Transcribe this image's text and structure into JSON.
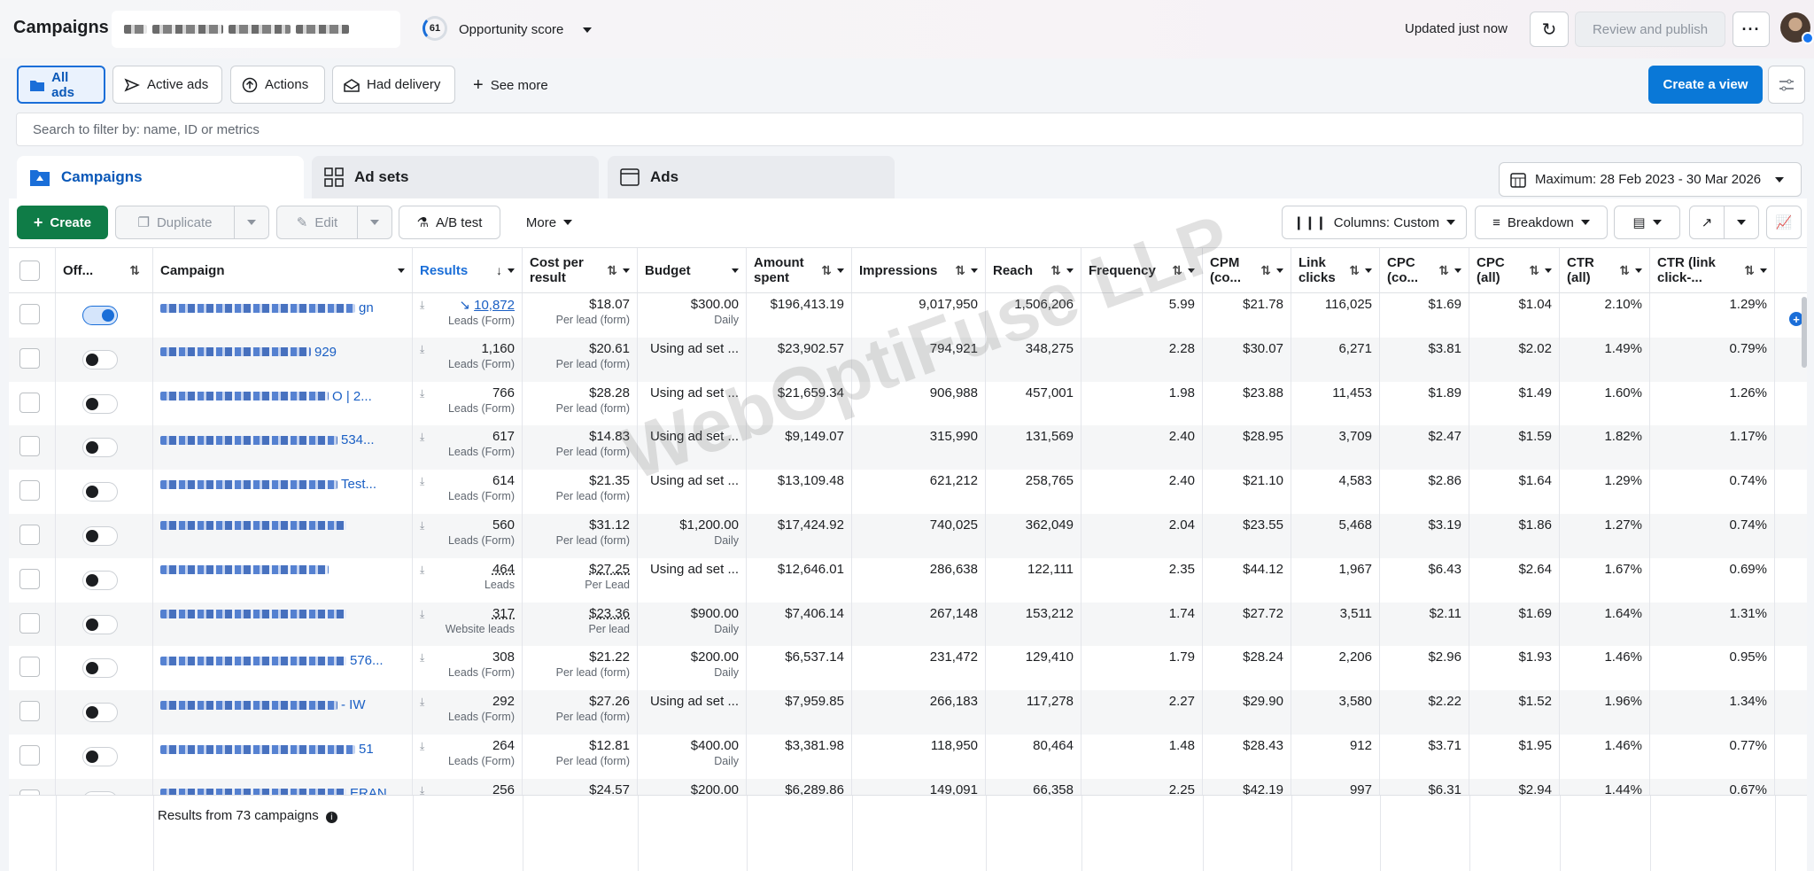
{
  "header": {
    "title": "Campaigns",
    "opportunity_score": "61",
    "opportunity_label": "Opportunity score",
    "updated": "Updated just now",
    "review_publish": "Review and publish"
  },
  "filters": {
    "chips": [
      "All ads",
      "Active ads",
      "Actions",
      "Had delivery"
    ],
    "see_more": "See more",
    "create_view": "Create a view"
  },
  "search": {
    "placeholder": "Search to filter by: name, ID or metrics"
  },
  "levels": {
    "campaigns": "Campaigns",
    "ad_sets": "Ad sets",
    "ads": "Ads"
  },
  "date_range": "Maximum: 28 Feb 2023 - 30 Mar 2026",
  "toolbar": {
    "create": "Create",
    "duplicate": "Duplicate",
    "edit": "Edit",
    "ab_test": "A/B test",
    "more": "More",
    "columns": "Columns: Custom",
    "breakdown": "Breakdown"
  },
  "columns": [
    "Off...",
    "Campaign",
    "Results",
    "Cost per result",
    "Budget",
    "Amount spent",
    "Impressions",
    "Reach",
    "Frequency",
    "CPM (co...",
    "Link clicks",
    "CPC (co...",
    "CPC (all)",
    "CTR (all)",
    "CTR (link click-..."
  ],
  "rows": [
    {
      "name_visible": "gn",
      "on": true,
      "results": "10,872",
      "results_type": "Leads (Form)",
      "cpr": "$18.07",
      "cpr_type": "Per lead (form)",
      "budget": "$300.00",
      "budget_type": "Daily",
      "spent": "$196,413.19",
      "impressions": "9,017,950",
      "reach": "1,506,206",
      "frequency": "5.99",
      "cpm": "$21.78",
      "link_clicks": "116,025",
      "cpc_co": "$1.69",
      "cpc_all": "$1.04",
      "ctr_all": "2.10%",
      "ctr_link": "1.29%"
    },
    {
      "name_visible": "929",
      "on": false,
      "results": "1,160",
      "results_type": "Leads (Form)",
      "cpr": "$20.61",
      "cpr_type": "Per lead (form)",
      "budget": "Using ad set ...",
      "budget_type": "",
      "spent": "$23,902.57",
      "impressions": "794,921",
      "reach": "348,275",
      "frequency": "2.28",
      "cpm": "$30.07",
      "link_clicks": "6,271",
      "cpc_co": "$3.81",
      "cpc_all": "$2.02",
      "ctr_all": "1.49%",
      "ctr_link": "0.79%"
    },
    {
      "name_visible": "O | 2...",
      "on": false,
      "results": "766",
      "results_type": "Leads (Form)",
      "cpr": "$28.28",
      "cpr_type": "Per lead (form)",
      "budget": "Using ad set ...",
      "budget_type": "",
      "spent": "$21,659.34",
      "impressions": "906,988",
      "reach": "457,001",
      "frequency": "1.98",
      "cpm": "$23.88",
      "link_clicks": "11,453",
      "cpc_co": "$1.89",
      "cpc_all": "$1.49",
      "ctr_all": "1.60%",
      "ctr_link": "1.26%"
    },
    {
      "name_visible": "534...",
      "on": false,
      "results": "617",
      "results_type": "Leads (Form)",
      "cpr": "$14.83",
      "cpr_type": "Per lead (form)",
      "budget": "Using ad set ...",
      "budget_type": "",
      "spent": "$9,149.07",
      "impressions": "315,990",
      "reach": "131,569",
      "frequency": "2.40",
      "cpm": "$28.95",
      "link_clicks": "3,709",
      "cpc_co": "$2.47",
      "cpc_all": "$1.59",
      "ctr_all": "1.82%",
      "ctr_link": "1.17%"
    },
    {
      "name_visible": "Test...",
      "on": false,
      "results": "614",
      "results_type": "Leads (Form)",
      "cpr": "$21.35",
      "cpr_type": "Per lead (form)",
      "budget": "Using ad set ...",
      "budget_type": "",
      "spent": "$13,109.48",
      "impressions": "621,212",
      "reach": "258,765",
      "frequency": "2.40",
      "cpm": "$21.10",
      "link_clicks": "4,583",
      "cpc_co": "$2.86",
      "cpc_all": "$1.64",
      "ctr_all": "1.29%",
      "ctr_link": "0.74%"
    },
    {
      "name_visible": "",
      "on": false,
      "results": "560",
      "results_type": "Leads (Form)",
      "cpr": "$31.12",
      "cpr_type": "Per lead (form)",
      "budget": "$1,200.00",
      "budget_type": "Daily",
      "spent": "$17,424.92",
      "impressions": "740,025",
      "reach": "362,049",
      "frequency": "2.04",
      "cpm": "$23.55",
      "link_clicks": "5,468",
      "cpc_co": "$3.19",
      "cpc_all": "$1.86",
      "ctr_all": "1.27%",
      "ctr_link": "0.74%"
    },
    {
      "name_visible": "",
      "on": false,
      "results": "464",
      "results_type": "Leads",
      "cpr": "$27.25",
      "cpr_type": "Per Lead",
      "budget": "Using ad set ...",
      "budget_type": "",
      "spent": "$12,646.01",
      "impressions": "286,638",
      "reach": "122,111",
      "frequency": "2.35",
      "cpm": "$44.12",
      "link_clicks": "1,967",
      "cpc_co": "$6.43",
      "cpc_all": "$2.64",
      "ctr_all": "1.67%",
      "ctr_link": "0.69%"
    },
    {
      "name_visible": "",
      "on": false,
      "results": "317",
      "results_type": "Website leads",
      "cpr": "$23.36",
      "cpr_type": "Per lead",
      "budget": "$900.00",
      "budget_type": "Daily",
      "spent": "$7,406.14",
      "impressions": "267,148",
      "reach": "153,212",
      "frequency": "1.74",
      "cpm": "$27.72",
      "link_clicks": "3,511",
      "cpc_co": "$2.11",
      "cpc_all": "$1.69",
      "ctr_all": "1.64%",
      "ctr_link": "1.31%"
    },
    {
      "name_visible": "576...",
      "on": false,
      "results": "308",
      "results_type": "Leads (Form)",
      "cpr": "$21.22",
      "cpr_type": "Per lead (form)",
      "budget": "$200.00",
      "budget_type": "Daily",
      "spent": "$6,537.14",
      "impressions": "231,472",
      "reach": "129,410",
      "frequency": "1.79",
      "cpm": "$28.24",
      "link_clicks": "2,206",
      "cpc_co": "$2.96",
      "cpc_all": "$1.93",
      "ctr_all": "1.46%",
      "ctr_link": "0.95%"
    },
    {
      "name_visible": "- IW",
      "on": false,
      "results": "292",
      "results_type": "Leads (Form)",
      "cpr": "$27.26",
      "cpr_type": "Per lead (form)",
      "budget": "Using ad set ...",
      "budget_type": "",
      "spent": "$7,959.85",
      "impressions": "266,183",
      "reach": "117,278",
      "frequency": "2.27",
      "cpm": "$29.90",
      "link_clicks": "3,580",
      "cpc_co": "$2.22",
      "cpc_all": "$1.52",
      "ctr_all": "1.96%",
      "ctr_link": "1.34%"
    },
    {
      "name_visible": "51",
      "on": false,
      "results": "264",
      "results_type": "Leads (Form)",
      "cpr": "$12.81",
      "cpr_type": "Per lead (form)",
      "budget": "$400.00",
      "budget_type": "Daily",
      "spent": "$3,381.98",
      "impressions": "118,950",
      "reach": "80,464",
      "frequency": "1.48",
      "cpm": "$28.43",
      "link_clicks": "912",
      "cpc_co": "$3.71",
      "cpc_all": "$1.95",
      "ctr_all": "1.46%",
      "ctr_link": "0.77%"
    },
    {
      "name_visible": "ERAN...",
      "on": false,
      "results": "256",
      "results_type": "",
      "cpr": "$24.57",
      "cpr_type": "",
      "budget": "$200.00",
      "budget_type": "",
      "spent": "$6,289.86",
      "impressions": "149,091",
      "reach": "66,358",
      "frequency": "2.25",
      "cpm": "$42.19",
      "link_clicks": "997",
      "cpc_co": "$6.31",
      "cpc_all": "$2.94",
      "ctr_all": "1.44%",
      "ctr_link": "0.67%"
    }
  ],
  "footer": "Results from 73 campaigns",
  "watermark": "WebOptiFuse LLP",
  "colors": {
    "primary_blue": "#0a78d7",
    "create_green": "#0f7c47",
    "link_blue": "#1a5fc4"
  }
}
